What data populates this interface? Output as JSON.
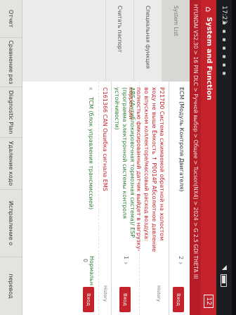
{
  "status": {
    "time": "17:23",
    "icons": "▪ ▪ ▪ ▪ ▪ ▪ ▪",
    "wifi": "◥",
    "battery_icon": "battery-icon"
  },
  "titlebar": {
    "title": "System and Function",
    "count": "12"
  },
  "breadcrumb": "HYUNDAI V52.30 > 16 PIN DLC > Ручной выбор > Общее > Tucson(NX4) > 2024 > G 2.5 GDI THETA III",
  "sidebar": {
    "items": [
      {
        "label": "System List"
      },
      {
        "label": "Специальная функция"
      },
      {
        "label": "Считать паспорт"
      }
    ]
  },
  "rows": {
    "ecm": {
      "label": "ECM (Модуль Контроля Двигателя)",
      "value": "2"
    },
    "dtc": {
      "label": "P217D0 Система сжимаемой обратной на холостом ходу не выше Ёмкость ↑  P0014P Абсолютное давление во впускном коллекторе/массовый расход воздуха: полностью фиксированный датчик выйдет в нагрузку-коррекции"
    },
    "abs": {
      "label": "ABS (Антиблокировочная тормозная система)/ ESP (программа электронной системы контроля устойчивости)",
      "value": "1"
    },
    "can": {
      "label": "C161366 CAN Ошибка сигнала EMS"
    },
    "tcm": {
      "label": "TCM (блок управления трансмиссией)",
      "value": "0",
      "status": "Нормальн"
    }
  },
  "right": {
    "btn1": "Вход",
    "label1": "History",
    "btn2": "Вход",
    "label2": "History",
    "btn3": "Вход"
  },
  "bottom": {
    "buttons": [
      "Отчет",
      "Сравнение рез",
      "Diagnostic Plan",
      "Удаление кодо",
      "Исправление о",
      "перевод"
    ]
  }
}
